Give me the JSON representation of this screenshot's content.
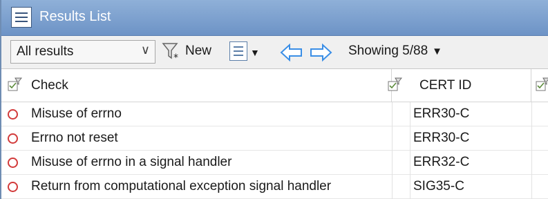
{
  "window": {
    "title": "Results List",
    "title_icon": "list-window-icon"
  },
  "toolbar": {
    "filter": {
      "selected": "All results",
      "icon": "chevron-down-icon"
    },
    "new_label": "New",
    "new_icon": "new-filter-funnel-icon",
    "view_icon": "column-view-icon",
    "nav_back_icon": "arrow-left-icon",
    "nav_forward_icon": "arrow-right-icon",
    "showing_label": "Showing 5/88"
  },
  "table": {
    "columns": [
      {
        "label": "",
        "icon": "filter-column-icon"
      },
      {
        "label": "Check",
        "icon": "filter-column-icon"
      },
      {
        "label": "CERT ID",
        "icon": "filter-column-icon"
      }
    ],
    "rows": [
      {
        "status_icon": "unreviewed-circle-icon",
        "check": "Misuse of errno",
        "cert_id": "ERR30-C"
      },
      {
        "status_icon": "unreviewed-circle-icon",
        "check": "Errno not reset",
        "cert_id": "ERR30-C"
      },
      {
        "status_icon": "unreviewed-circle-icon",
        "check": "Misuse of errno in a signal handler",
        "cert_id": "ERR32-C"
      },
      {
        "status_icon": "unreviewed-circle-icon",
        "check": "Return from computational exception signal handler",
        "cert_id": "SIG35-C"
      }
    ]
  },
  "colors": {
    "titlebar": "#7a9fcf",
    "status_red": "#d23a3a",
    "nav_arrow": "#3a8ee6"
  }
}
